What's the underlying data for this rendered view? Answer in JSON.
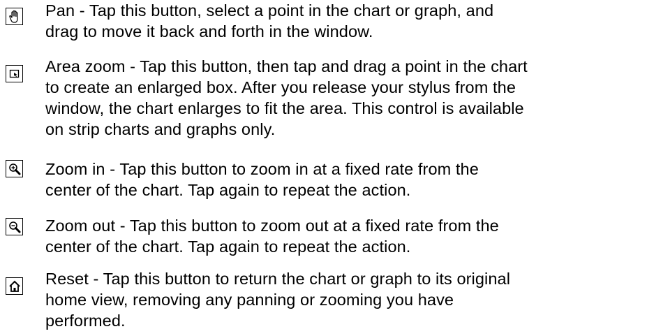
{
  "controls": [
    {
      "icon": "pan-hand-icon",
      "text": "Pan - Tap this button, select a point in the chart or graph, and\ndrag to move it back and forth in the window."
    },
    {
      "icon": "area-zoom-icon",
      "text": "Area zoom - Tap this button, then tap and drag a point in the chart\nto create an enlarged box. After you release your stylus from the\nwindow, the chart enlarges to fit the area. This control is available\non strip charts and graphs only."
    },
    {
      "icon": "zoom-in-icon",
      "text": "Zoom in - Tap this button to zoom in at a fixed rate from the\ncenter of the chart. Tap again to repeat the action."
    },
    {
      "icon": "zoom-out-icon",
      "text": "Zoom out - Tap this button to zoom out at a fixed rate from the\ncenter of the chart. Tap again to repeat the action."
    },
    {
      "icon": "home-icon",
      "text": "Reset - Tap this button to return the chart or graph to its original\nhome view, removing any panning or zooming you have\nperformed."
    }
  ]
}
